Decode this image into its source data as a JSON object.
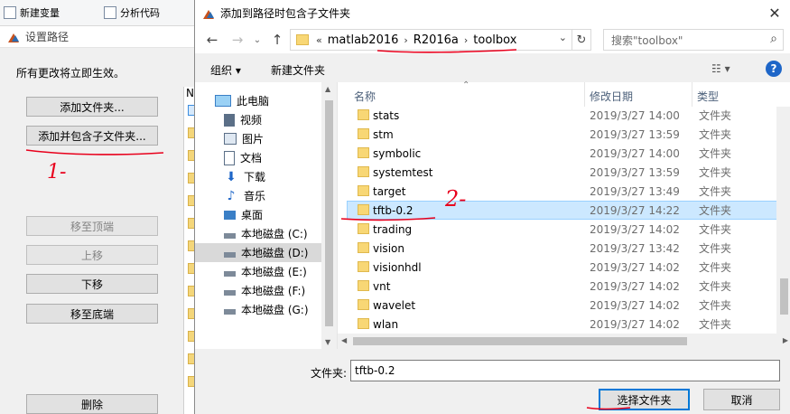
{
  "background_window": {
    "toolbar": {
      "new_variable": "新建变量",
      "analyze_code": "分析代码"
    },
    "title": "设置路径",
    "message": "所有更改将立即生效。",
    "buttons": {
      "add_folder": "添加文件夹...",
      "add_with_subfolders": "添加并包含子文件夹...",
      "move_to_top": "移至顶端",
      "move_up": "上移",
      "move_down": "下移",
      "move_to_bottom": "移至底端",
      "remove": "删除"
    },
    "strip_header": "N"
  },
  "annotations": {
    "mark1": "1-",
    "mark2": "2-"
  },
  "dialog": {
    "title": "添加到路径时包含子文件夹",
    "close": "✕",
    "nav": {
      "back": "←",
      "forward": "→",
      "up": "↑",
      "breadcrumb_prefix": "«",
      "breadcrumbs": [
        "matlab2016",
        "R2016a",
        "toolbox"
      ],
      "crumb_sep": "›",
      "dropdown": "⌄",
      "refresh": "↻",
      "search_placeholder": "搜索\"toolbox\"",
      "search_icon": "⌕"
    },
    "commandbar": {
      "organize": "组织 ▾",
      "new_folder": "新建文件夹",
      "view_icon": "☷ ▾",
      "help": "?"
    },
    "nav_pane": [
      {
        "label": "此电脑",
        "icon": "computer-icon"
      },
      {
        "label": "视频",
        "icon": "video-icon"
      },
      {
        "label": "图片",
        "icon": "picture-icon"
      },
      {
        "label": "文档",
        "icon": "document-icon"
      },
      {
        "label": "下载",
        "icon": "download-icon"
      },
      {
        "label": "音乐",
        "icon": "music-icon"
      },
      {
        "label": "桌面",
        "icon": "desktop-icon"
      },
      {
        "label": "本地磁盘 (C:)",
        "icon": "drive-icon"
      },
      {
        "label": "本地磁盘 (D:)",
        "icon": "drive-icon",
        "selected": true
      },
      {
        "label": "本地磁盘 (E:)",
        "icon": "drive-icon"
      },
      {
        "label": "本地磁盘 (F:)",
        "icon": "drive-icon"
      },
      {
        "label": "本地磁盘 (G:)",
        "icon": "drive-icon"
      }
    ],
    "columns": {
      "name": "名称",
      "date": "修改日期",
      "type": "类型"
    },
    "files": [
      {
        "name": "stats",
        "date": "2019/3/27 14:00",
        "type": "文件夹"
      },
      {
        "name": "stm",
        "date": "2019/3/27 13:59",
        "type": "文件夹"
      },
      {
        "name": "symbolic",
        "date": "2019/3/27 14:00",
        "type": "文件夹"
      },
      {
        "name": "systemtest",
        "date": "2019/3/27 13:59",
        "type": "文件夹"
      },
      {
        "name": "target",
        "date": "2019/3/27 13:49",
        "type": "文件夹"
      },
      {
        "name": "tftb-0.2",
        "date": "2019/3/27 14:22",
        "type": "文件夹",
        "selected": true
      },
      {
        "name": "trading",
        "date": "2019/3/27 14:02",
        "type": "文件夹"
      },
      {
        "name": "vision",
        "date": "2019/3/27 13:42",
        "type": "文件夹"
      },
      {
        "name": "visionhdl",
        "date": "2019/3/27 14:02",
        "type": "文件夹"
      },
      {
        "name": "vnt",
        "date": "2019/3/27 14:02",
        "type": "文件夹"
      },
      {
        "name": "wavelet",
        "date": "2019/3/27 14:02",
        "type": "文件夹"
      },
      {
        "name": "wlan",
        "date": "2019/3/27 14:02",
        "type": "文件夹"
      }
    ],
    "folder_label": "文件夹:",
    "folder_value": "tftb-0.2",
    "select_button": "选择文件夹",
    "cancel_button": "取消"
  },
  "colors": {
    "selection": "#cce8ff",
    "annotation_red": "#e8001c",
    "folder": "#f8d775",
    "accent": "#0078d7"
  }
}
